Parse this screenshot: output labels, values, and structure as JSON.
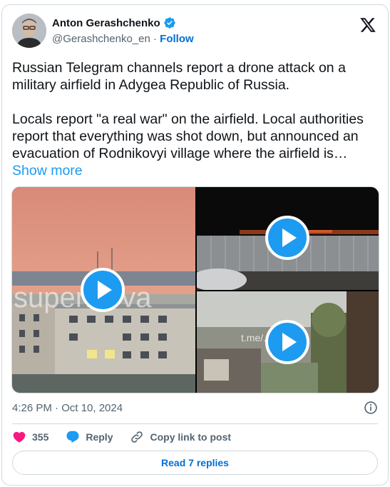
{
  "author": {
    "name": "Anton Gerashchenko",
    "handle": "@Gerashchenko_en",
    "separator": "·",
    "follow_label": "Follow"
  },
  "tweet": {
    "text": "Russian Telegram channels report a drone attack on a military airfield in Adygea Republic of Russia.\n\nLocals report \"a real war\" on the airfield. Local authorities report that everything was shot down, but announced an evacuation of Rodnikovyi village where the airfield is… ",
    "show_more_label": "Show more"
  },
  "media": {
    "videos": [
      {
        "name": "video-1",
        "watermark": "superNova"
      },
      {
        "name": "video-2",
        "watermark": ""
      },
      {
        "name": "video-3",
        "watermark": "t.me/...va_plus"
      }
    ]
  },
  "meta": {
    "timestamp": "4:26 PM · Oct 10, 2024"
  },
  "actions": {
    "like_count": "355",
    "reply_label": "Reply",
    "copy_link_label": "Copy link to post"
  },
  "footer": {
    "read_replies_label": "Read 7 replies"
  },
  "colors": {
    "accent": "#1d9bf0",
    "link": "#006fd6",
    "like": "#f91880",
    "muted": "#536471"
  },
  "icons": [
    "verified-badge-icon",
    "x-logo-icon",
    "play-icon",
    "info-icon",
    "heart-icon",
    "reply-icon",
    "link-icon"
  ]
}
